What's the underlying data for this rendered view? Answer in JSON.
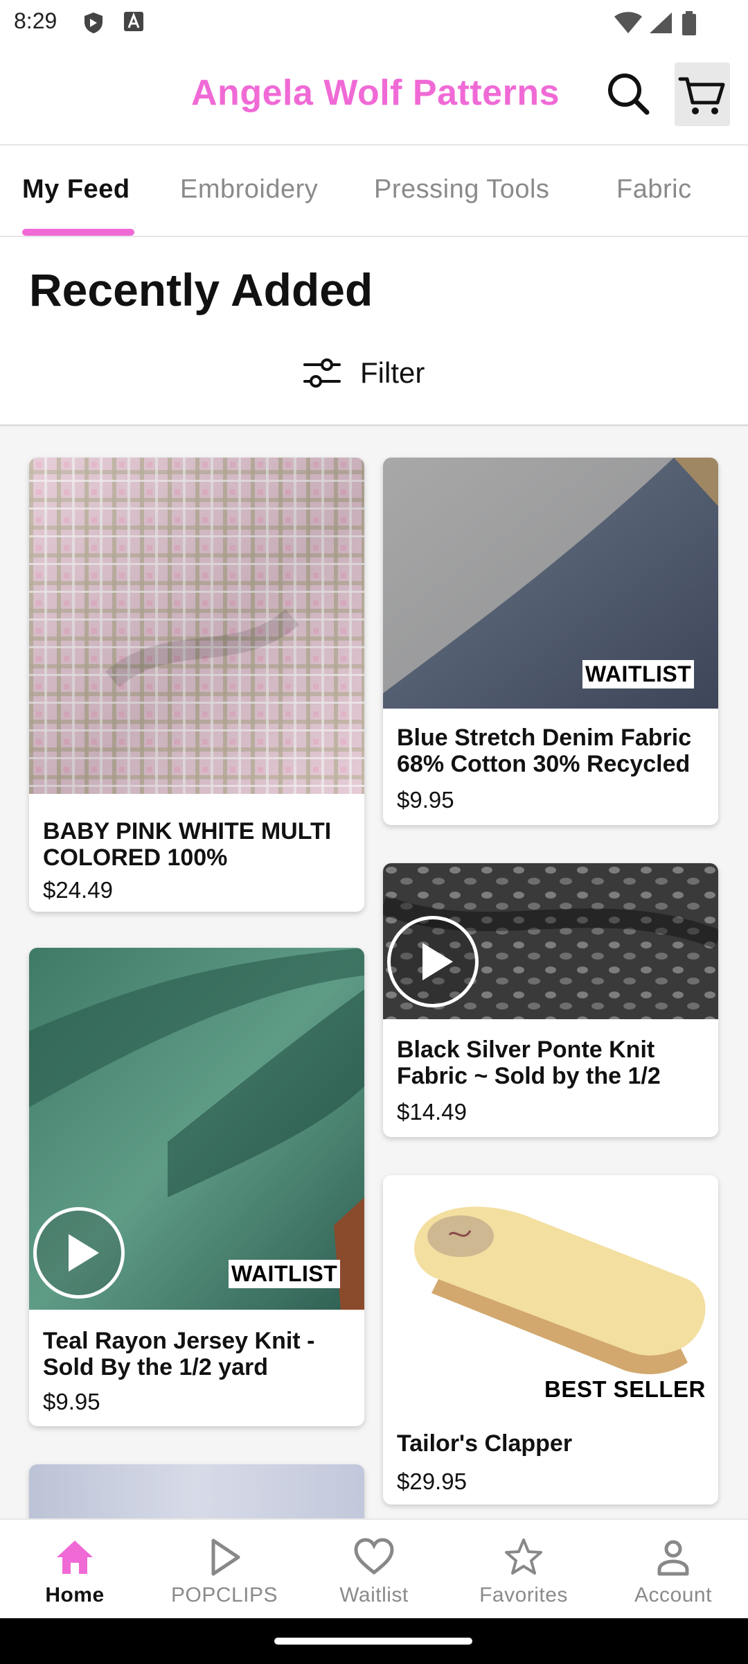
{
  "status_bar": {
    "time": "8:29",
    "icons": [
      "shield-icon",
      "font-a-icon",
      "wifi-icon",
      "signal-icon",
      "battery-icon"
    ]
  },
  "app_bar": {
    "title": "Angela Wolf Patterns",
    "title_color": "#f06ad6",
    "icons": [
      "search-icon",
      "cart-icon"
    ]
  },
  "tabs": [
    {
      "label": "My Feed",
      "active": true
    },
    {
      "label": "Embroidery",
      "active": false
    },
    {
      "label": "Pressing Tools",
      "active": false
    },
    {
      "label": "Fabric",
      "active": false
    }
  ],
  "section": {
    "title": "Recently Added",
    "filter_label": "Filter",
    "filter_icon": "sliders-icon"
  },
  "products": [
    {
      "title": "BABY PINK WHITE MULTI COLORED 100%",
      "price": "$24.49",
      "badge": "",
      "video": false
    },
    {
      "title": "Blue Stretch Denim Fabric 68% Cotton 30% Recycled",
      "price": "$9.95",
      "badge": "WAITLIST",
      "video": false
    },
    {
      "title": "Black Silver Ponte Knit Fabric ~ Sold by the 1/2",
      "price": "$14.49",
      "badge": "",
      "video": true
    },
    {
      "title": "Teal Rayon Jersey Knit - Sold By the 1/2 yard",
      "price": "$9.95",
      "badge": "WAITLIST",
      "video": true
    },
    {
      "title": "Tailor's Clapper",
      "price": "$29.95",
      "badge": "BEST SELLER",
      "video": false
    }
  ],
  "bottom_nav": [
    {
      "label": "Home",
      "icon": "home-icon",
      "active": true
    },
    {
      "label": "POPCLIPS",
      "icon": "play-outline-icon",
      "active": false
    },
    {
      "label": "Waitlist",
      "icon": "heart-icon",
      "active": false
    },
    {
      "label": "Favorites",
      "icon": "star-icon",
      "active": false
    },
    {
      "label": "Account",
      "icon": "person-icon",
      "active": false
    }
  ],
  "colors": {
    "accent": "#f06ad6"
  }
}
